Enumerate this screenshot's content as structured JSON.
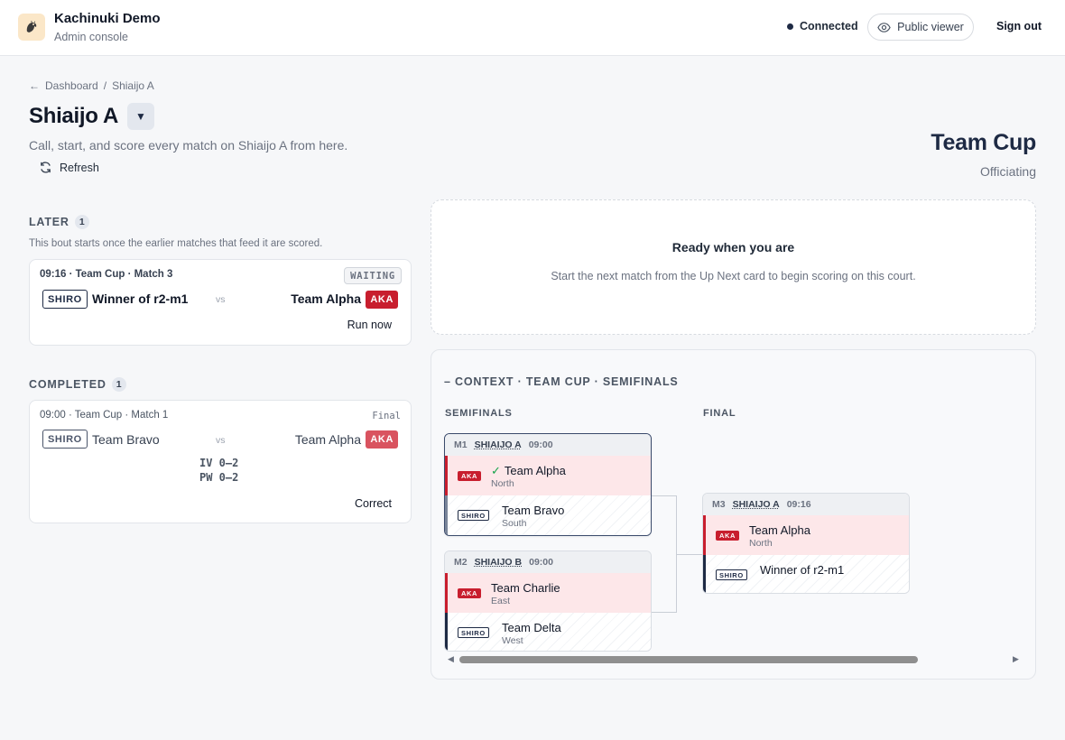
{
  "header": {
    "app_title": "Kachinuki Demo",
    "app_subtitle": "Admin console",
    "logo_icon": "dragon-logo",
    "connection_status": "Connected",
    "public_viewer_label": "Public viewer",
    "sign_out_label": "Sign out"
  },
  "breadcrumb": {
    "back_arrow": "←",
    "dashboard": "Dashboard",
    "separator": "/",
    "current": "Shiaijo A"
  },
  "page": {
    "title": "Shiaijo A",
    "dropdown_icon": "▼",
    "description": "Call, start, and score every match on Shiaijo A from here.",
    "refresh_label": "Refresh",
    "event_name": "Team Cup",
    "event_role": "Officiating"
  },
  "later": {
    "label": "LATER",
    "count": "1",
    "note": "This bout starts once the earlier matches that feed it are scored.",
    "match": {
      "meta": "09:16 · Team Cup · Match 3",
      "status": "WAITING",
      "shiro_tag": "SHIRO",
      "shiro_name": "Winner of r2-m1",
      "vs": "vs",
      "aka_name": "Team Alpha",
      "aka_tag": "AKA",
      "action": "Run now"
    }
  },
  "completed": {
    "label": "COMPLETED",
    "count": "1",
    "match": {
      "meta": "09:00 · Team Cup · Match 1",
      "status": "Final",
      "shiro_tag": "SHIRO",
      "shiro_name": "Team Bravo",
      "vs": "vs",
      "aka_name": "Team Alpha",
      "aka_tag": "AKA",
      "score_iv": "IV 0–2",
      "score_pw": "PW 0–2",
      "action": "Correct"
    }
  },
  "ready": {
    "title": "Ready when you are",
    "description": "Start the next match from the Up Next card to begin scoring on this court."
  },
  "context": {
    "title": "– CONTEXT · TEAM CUP · SEMIFINALS",
    "round_semis": "SEMIFINALS",
    "round_final": "FINAL",
    "matches": [
      {
        "id": "M1",
        "court": "SHIAIJO A",
        "time": "09:00",
        "aka": {
          "tag": "AKA",
          "check": "✓",
          "name": "Team Alpha",
          "region": "North"
        },
        "shiro": {
          "tag": "SHIRO",
          "name": "Team Bravo",
          "region": "South"
        }
      },
      {
        "id": "M2",
        "court": "SHIAIJO B",
        "time": "09:00",
        "aka": {
          "tag": "AKA",
          "name": "Team Charlie",
          "region": "East"
        },
        "shiro": {
          "tag": "SHIRO",
          "name": "Team Delta",
          "region": "West"
        }
      },
      {
        "id": "M3",
        "court": "SHIAIJO A",
        "time": "09:16",
        "aka": {
          "tag": "AKA",
          "name": "Team Alpha",
          "region": "North"
        },
        "shiro": {
          "tag": "SHIRO",
          "name": "Winner of r2-m1"
        }
      }
    ]
  },
  "colors": {
    "aka": "#c81e2e",
    "shiro": "#1e2a44",
    "accent": "#1e2a44",
    "winner_check": "#16a34a"
  }
}
